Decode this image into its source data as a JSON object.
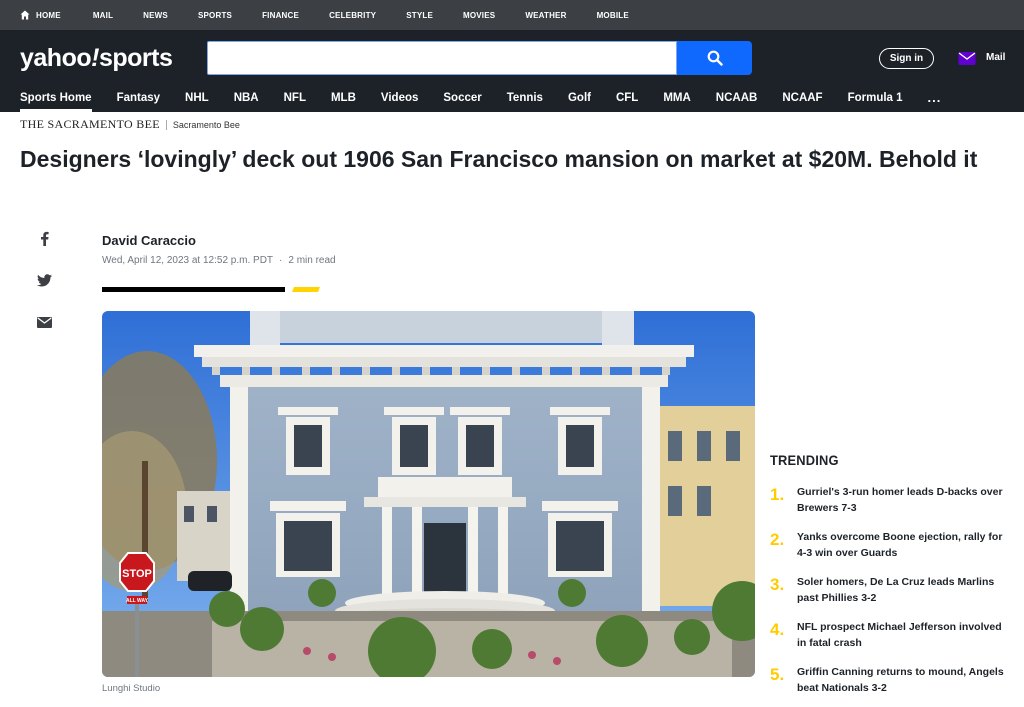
{
  "topnav": {
    "items": [
      "HOME",
      "MAIL",
      "NEWS",
      "SPORTS",
      "FINANCE",
      "CELEBRITY",
      "STYLE",
      "MOVIES",
      "WEATHER",
      "MOBILE"
    ]
  },
  "header": {
    "logo": "yahoo!sports",
    "logo_main": "yahoo",
    "logo_bang": "!",
    "logo_sub": "sports",
    "search": {
      "value": "",
      "placeholder": ""
    },
    "signin_label": "Sign in",
    "mail_label": "Mail"
  },
  "sportsnav": {
    "items": [
      "Sports Home",
      "Fantasy",
      "NHL",
      "NBA",
      "NFL",
      "MLB",
      "Videos",
      "Soccer",
      "Tennis",
      "Golf",
      "CFL",
      "MMA",
      "NCAAB",
      "NCAAF",
      "Formula 1"
    ],
    "active": "Sports Home",
    "more": "..."
  },
  "source": {
    "logo_text": "THE SACRAMENTO BEE",
    "name": "Sacramento Bee"
  },
  "article": {
    "headline": "Designers ‘lovingly’ deck out 1906 San Francisco mansion on market at $20M. Behold it",
    "author": "David Caraccio",
    "date": "Wed, April 12, 2023 at 12:52 p.m. PDT",
    "read_time": "2 min read",
    "image_caption": "Lunghi Studio",
    "stop_sign": "STOP",
    "stop_sub": "ALL WAY"
  },
  "share": {
    "icons": [
      "facebook-icon",
      "twitter-icon",
      "email-icon"
    ]
  },
  "trending": {
    "title": "TRENDING",
    "items": [
      {
        "num": "1.",
        "text": "Gurriel's 3-run homer leads D-backs over Brewers 7-3"
      },
      {
        "num": "2.",
        "text": "Yanks overcome Boone ejection, rally for 4-3 win over Guards"
      },
      {
        "num": "3.",
        "text": "Soler homers, De La Cruz leads Marlins past Phillies 3-2"
      },
      {
        "num": "4.",
        "text": "NFL prospect Michael Jefferson involved in fatal crash"
      },
      {
        "num": "5.",
        "text": "Griffin Canning returns to mound, Angels beat Nationals 3-2"
      }
    ]
  },
  "colors": {
    "topbar": "#3c4045",
    "header": "#1d2228",
    "search_button": "#0f69ff",
    "trending_number": "#ffcc00",
    "rule_accent": "#ffd400"
  }
}
